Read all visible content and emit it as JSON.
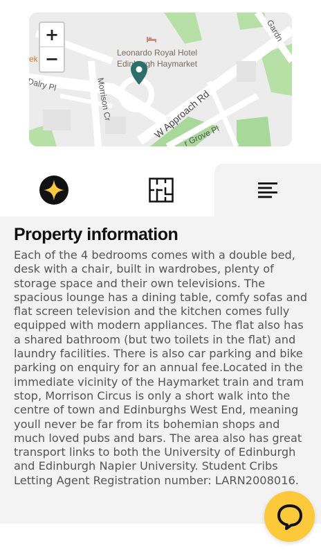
{
  "map": {
    "zoom_in_label": "+",
    "zoom_out_label": "−",
    "hotel_label_line1": "Leonardo Royal Hotel",
    "hotel_label_line2": "Edinburgh Haymarket",
    "street_labels": {
      "approach": "W Approach Rd",
      "morrison": "Morrison Cr",
      "dalry": "Dalry Pl",
      "grove": "r Grove Pl",
      "gardner": "Gardn",
      "left_edge": "ek"
    },
    "pin_color": "#2c6e6a"
  },
  "tabs": [
    {
      "icon": "sparkle-icon",
      "active": false
    },
    {
      "icon": "floorplan-icon",
      "active": false
    },
    {
      "icon": "text-lines-icon",
      "active": true
    }
  ],
  "property": {
    "heading": "Property information",
    "description": "Each of the 4 bedrooms comes with a double bed, desk with a chair, built in wardrobes, plenty of storage space and their own televisions. The spacious lounge has a dining table, comfy sofas and flat screen television and the kitchen comes fully equipped with modern appliances. The flat also has a shared bathroom (but two toilets in the flat) and laundry facilities. There is also car parking and bike parking on enquiry for an annual fee.Located in the immediate vicinity of the Haymarket train and tram stop, Morrison Circus is only a short walk into the centre of town and Edinburghs West End, meaning youll never be far from its bohemian shops and much loved pubs and bars. The area also has great transport links to both the University of Edinburgh and Edinburgh Napier University. Student Cribs Letting Agent Registration number: LARN2008016."
  },
  "chat": {
    "icon": "chat-bubble-icon",
    "color": "#fbc93a"
  },
  "colors": {
    "panel_bg": "#f3f3f3",
    "accent": "#fbc93a",
    "green": "#a8d89a"
  }
}
